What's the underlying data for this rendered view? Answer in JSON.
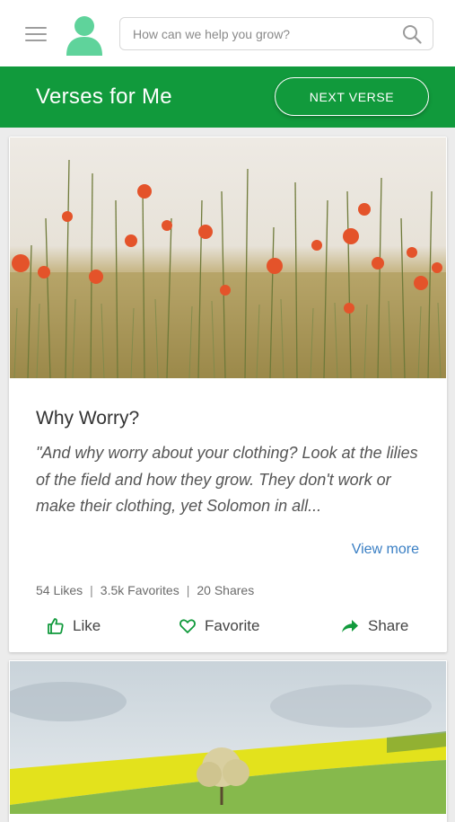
{
  "header": {
    "search_placeholder": "How can we help you grow?"
  },
  "banner": {
    "title": "Verses for Me",
    "next_label": "NEXT VERSE"
  },
  "verse_card": {
    "title": "Why Worry?",
    "quote": "\"And why worry about your clothing? Look at the lilies of the field and how they grow. They don't work or make their clothing, yet Solomon in all...",
    "view_more": "View more",
    "stats": {
      "likes": "54 Likes",
      "favorites": "3.5k Favorites",
      "shares": "20 Shares"
    },
    "actions": {
      "like": "Like",
      "favorite": "Favorite",
      "share": "Share"
    }
  },
  "colors": {
    "brand_green": "#119a3c",
    "avatar_green": "#5fd39b",
    "link_blue": "#3a7fc4"
  },
  "icons": [
    "menu-icon",
    "user-avatar-icon",
    "search-icon",
    "thumbs-up-icon",
    "heart-icon",
    "share-arrow-icon"
  ]
}
